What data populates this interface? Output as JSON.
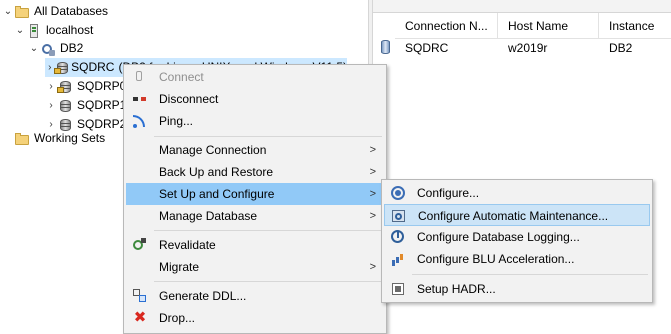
{
  "tree": {
    "all_databases": "All Databases",
    "localhost": "localhost",
    "instance": "DB2",
    "databases": [
      {
        "name": "SQDRC",
        "desc": "(DB2 for Linux, UNIX, and Windows V11.5)"
      },
      {
        "name": "SQDRP0"
      },
      {
        "name": "SQDRP1"
      },
      {
        "name": "SQDRP2"
      }
    ],
    "working_sets": "Working Sets"
  },
  "table": {
    "columns": [
      "Connection N...",
      "Host Name",
      "Instance"
    ],
    "rows": [
      [
        "SQDRC",
        "w2019r",
        "DB2"
      ]
    ]
  },
  "menu": {
    "connect": "Connect",
    "disconnect": "Disconnect",
    "ping": "Ping...",
    "manage_connection": "Manage Connection",
    "backup_restore": "Back Up and Restore",
    "setup_configure": "Set Up and Configure",
    "manage_database": "Manage Database",
    "revalidate": "Revalidate",
    "migrate": "Migrate",
    "generate_ddl": "Generate DDL...",
    "drop": "Drop...",
    "arrow": ">"
  },
  "submenu": {
    "configure": "Configure...",
    "configure_auto_maint": "Configure Automatic Maintenance...",
    "configure_logging": "Configure Database Logging...",
    "configure_blu": "Configure BLU Acceleration...",
    "setup_hadr": "Setup HADR..."
  },
  "icons": {
    "twisty_expanded": "⌄",
    "twisty_collapsed": "›",
    "drop": "✖"
  }
}
